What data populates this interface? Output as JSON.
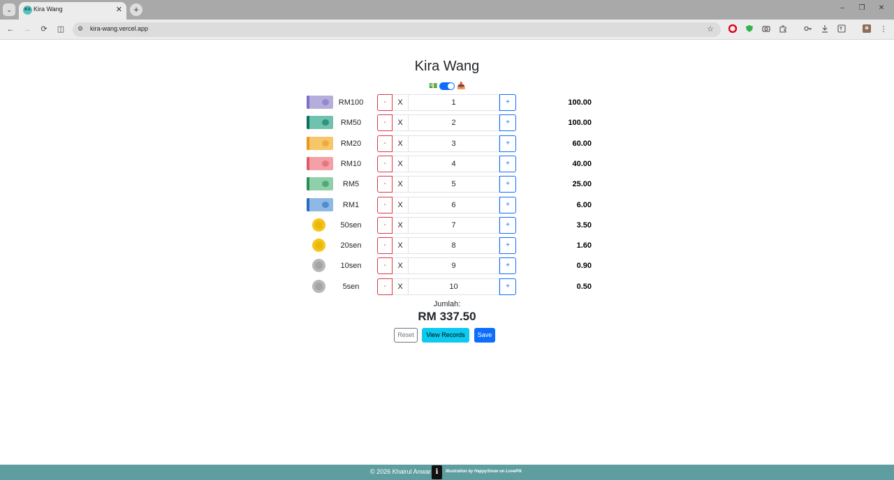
{
  "browser": {
    "tab_title": "Kira Wang",
    "tab_favicon_text": "KA",
    "url": "kira-wang.vercel.app",
    "controls": {
      "tab_menu": "⌄",
      "tab_close": "✕",
      "new_tab": "+",
      "minimize": "–",
      "restore": "❐",
      "close": "✕",
      "back": "←",
      "forward": "→",
      "reload": "⟳",
      "split": "◫",
      "site_info": "⚙",
      "bookmark": "☆",
      "menu": "⋮"
    },
    "extensions": [
      "opera-icon",
      "shield-icon",
      "camera-icon",
      "puzzle-icon",
      "key-icon",
      "download-icon",
      "translate-icon",
      "profile-avatar"
    ]
  },
  "app": {
    "title": "Kira Wang",
    "mode_icons": {
      "left": "💵",
      "right": "📥"
    },
    "mode_toggle_on": true,
    "multiply_symbol": "X",
    "minus_label": "-",
    "plus_label": "+",
    "denominations": [
      {
        "label": "RM100",
        "type": "note",
        "color": "#b5aedc",
        "accent": "#7c71c4",
        "quantity": "1",
        "subtotal": "100.00"
      },
      {
        "label": "RM50",
        "type": "note",
        "color": "#6fc3ae",
        "accent": "#0f6e5e",
        "quantity": "2",
        "subtotal": "100.00"
      },
      {
        "label": "RM20",
        "type": "note",
        "color": "#f7c56a",
        "accent": "#e69a22",
        "quantity": "3",
        "subtotal": "60.00"
      },
      {
        "label": "RM10",
        "type": "note",
        "color": "#f3a0a6",
        "accent": "#de5b67",
        "quantity": "4",
        "subtotal": "40.00"
      },
      {
        "label": "RM5",
        "type": "note",
        "color": "#8fd0a8",
        "accent": "#2a8d55",
        "quantity": "5",
        "subtotal": "25.00"
      },
      {
        "label": "RM1",
        "type": "note",
        "color": "#8eb9e6",
        "accent": "#2b6cc0",
        "quantity": "6",
        "subtotal": "6.00"
      },
      {
        "label": "50sen",
        "type": "coin",
        "color": "#f5c518",
        "accent": "#e0ac00",
        "quantity": "7",
        "subtotal": "3.50"
      },
      {
        "label": "20sen",
        "type": "coin",
        "color": "#f5c518",
        "accent": "#e0ac00",
        "quantity": "8",
        "subtotal": "1.60"
      },
      {
        "label": "10sen",
        "type": "coin",
        "color": "#b8b8b8",
        "accent": "#8f8f8f",
        "quantity": "9",
        "subtotal": "0.90"
      },
      {
        "label": "5sen",
        "type": "coin",
        "color": "#b8b8b8",
        "accent": "#8f8f8f",
        "quantity": "10",
        "subtotal": "0.50"
      }
    ],
    "total_label": "Jumlah:",
    "total_value": "RM 337.50",
    "buttons": {
      "reset": "Reset",
      "view_records": "View Records",
      "save": "Save"
    }
  },
  "footer": {
    "copyright": "© 2026 Khairul Anwar",
    "info_icon": "i",
    "credit": "Illustration by HappySnow on LovePik"
  },
  "colors": {
    "primary": "#0d6efd",
    "danger": "#dc3545",
    "info": "#0dcaf0",
    "secondary": "#6c757d",
    "footer": "#5f9ea0"
  }
}
